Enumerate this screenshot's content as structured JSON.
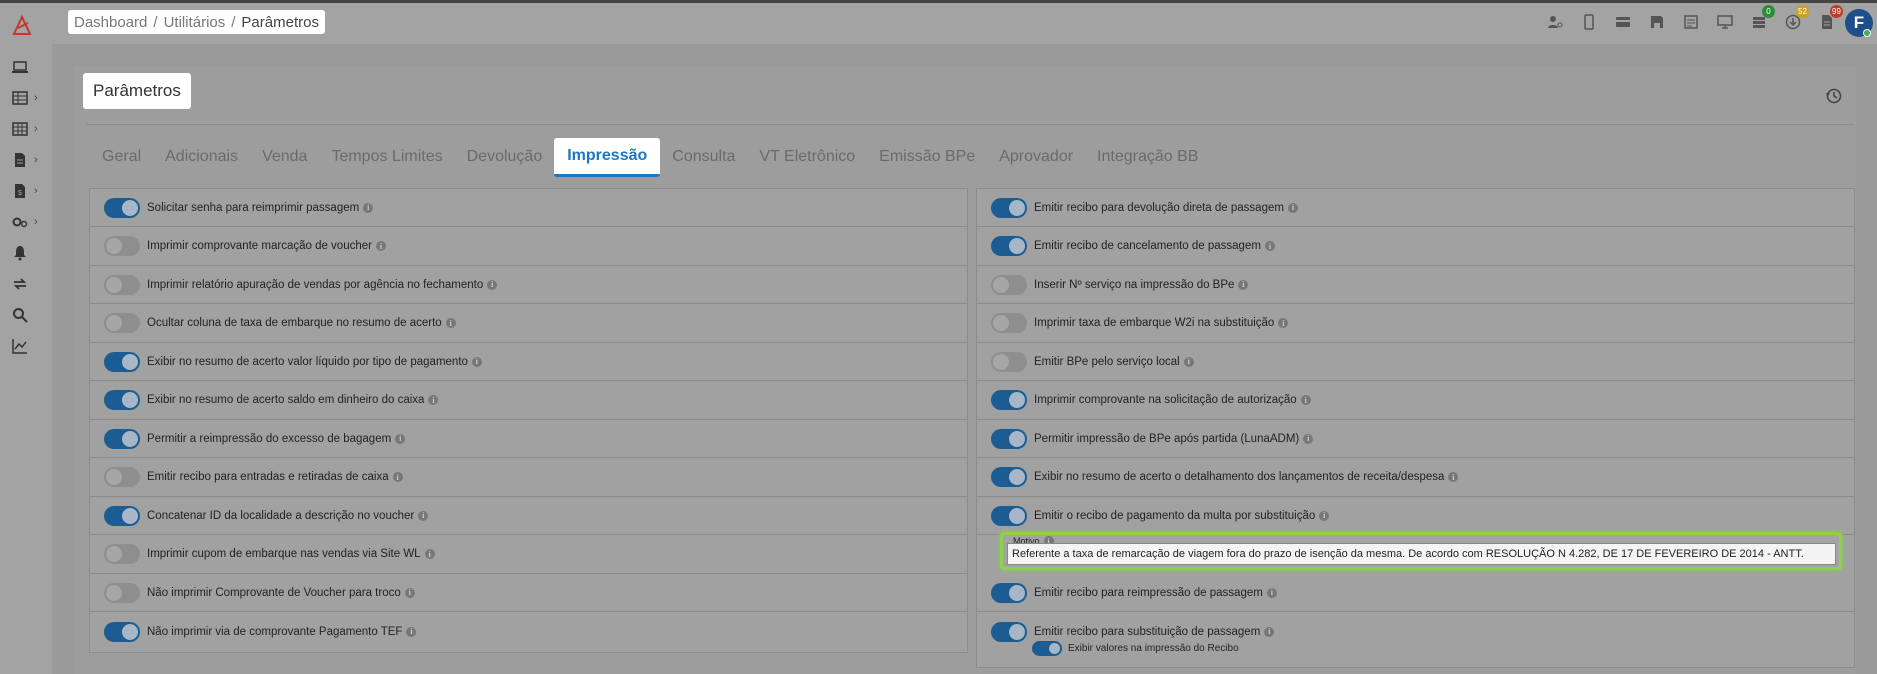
{
  "breadcrumb": {
    "items": [
      "Dashboard",
      "Utilitários"
    ],
    "current": "Parâmetros"
  },
  "top_icons": [
    {
      "name": "user-settings-icon"
    },
    {
      "name": "mobile-icon"
    },
    {
      "name": "card-icon"
    },
    {
      "name": "save-icon"
    },
    {
      "name": "receipt-list-icon"
    },
    {
      "name": "monitor-icon"
    },
    {
      "name": "queue-icon",
      "badge": "0",
      "badge_color": "#2e8b3c"
    },
    {
      "name": "download-icon",
      "badge": "52",
      "badge_color": "#c9a21c"
    },
    {
      "name": "document-icon",
      "badge": "99",
      "badge_color": "#c0392b"
    }
  ],
  "avatar": {
    "initial": "F"
  },
  "page": {
    "title": "Parâmetros"
  },
  "tabs": [
    "Geral",
    "Adicionais",
    "Venda",
    "Tempos Limites",
    "Devolução",
    "Impressão",
    "Consulta",
    "VT Eletrônico",
    "Emissão BPe",
    "Aprovador",
    "Integração BB"
  ],
  "active_tab": "Impressão",
  "left_settings": [
    {
      "label": "Solicitar senha para reimprimir passagem",
      "on": true
    },
    {
      "label": "Imprimir comprovante marcação de voucher",
      "on": false
    },
    {
      "label": "Imprimir relatório apuração de vendas por agência no fechamento",
      "on": false
    },
    {
      "label": "Ocultar coluna de taxa de embarque no resumo de acerto",
      "on": false
    },
    {
      "label": "Exibir no resumo de acerto valor líquido por tipo de pagamento",
      "on": true
    },
    {
      "label": "Exibir no resumo de acerto saldo em dinheiro do caixa",
      "on": true
    },
    {
      "label": "Permitir a reimpressão do excesso de bagagem",
      "on": true
    },
    {
      "label": "Emitir recibo para entradas e retiradas de caixa",
      "on": false
    },
    {
      "label": "Concatenar ID da localidade a descrição no voucher",
      "on": true
    },
    {
      "label": "Imprimir cupom de embarque nas vendas via Site WL",
      "on": false
    },
    {
      "label": "Não imprimir Comprovante de Voucher para troco",
      "on": false
    },
    {
      "label": "Não imprimir via de comprovante Pagamento TEF",
      "on": true
    }
  ],
  "right_settings": [
    {
      "label": "Emitir recibo para devolução direta de passagem",
      "on": true
    },
    {
      "label": "Emitir recibo de cancelamento de passagem",
      "on": true
    },
    {
      "label": "Inserir Nº serviço na impressão do BPe",
      "on": false
    },
    {
      "label": "Imprimir taxa de embarque W2i na substituição",
      "on": false
    },
    {
      "label": "Emitir BPe pelo serviço local",
      "on": false
    },
    {
      "label": "Imprimir comprovante na solicitação de autorização",
      "on": true
    },
    {
      "label": "Permitir impressão de BPe após partida (LunaADM)",
      "on": true
    },
    {
      "label": "Exibir no resumo de acerto o detalhamento dos lançamentos de receita/despesa",
      "on": true
    },
    {
      "label": "Emitir o recibo de pagamento da multa por substituição",
      "on": true
    },
    {
      "label": "Emitir recibo para reimpressão de passagem",
      "on": true
    },
    {
      "label": "Emitir recibo para substituição de passagem",
      "on": true
    }
  ],
  "motivo": {
    "label": "Motivo",
    "value": "Referente a taxa de remarcação de viagem fora do prazo de isenção da mesma. De acordo com RESOLUÇÃO N 4.282, DE 17 DE FEVEREIRO DE 2014 - ANTT."
  },
  "sub_setting": {
    "label": "Exibir valores na impressão do Recibo",
    "on": true
  },
  "info_glyph": "i"
}
